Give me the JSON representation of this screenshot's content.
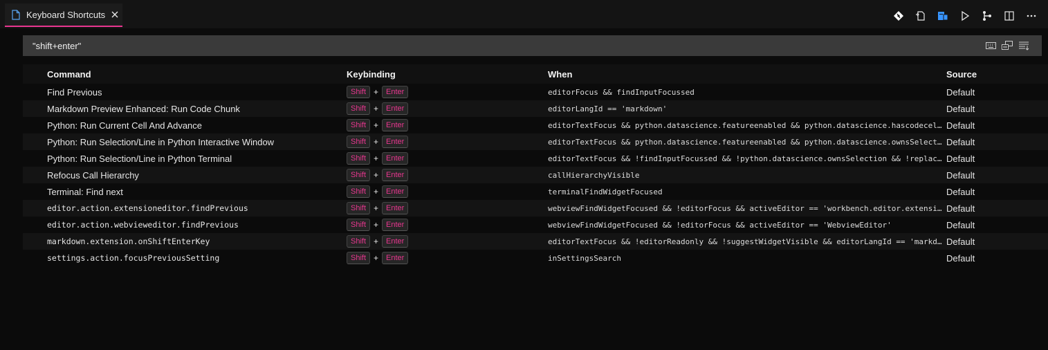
{
  "tab": {
    "label": "Keyboard Shortcuts"
  },
  "icons": {
    "file": "file-icon",
    "close": "close-icon",
    "actions": [
      "git-compare-icon",
      "open-file-icon",
      "preview-icon",
      "run-icon",
      "source-control-icon",
      "split-editor-icon",
      "more-icon"
    ],
    "search_tools": [
      "keyboard-icon",
      "record-keys-icon",
      "sort-by-precedence-icon"
    ]
  },
  "colors": {
    "accent": "#e8368f",
    "search_bg": "#3a3a3a",
    "blue_icon": "#3794ff"
  },
  "search": {
    "value": "\"shift+enter\""
  },
  "columns": {
    "command": "Command",
    "keybinding": "Keybinding",
    "when": "When",
    "source": "Source"
  },
  "rows": [
    {
      "command": "Find Previous",
      "keys": [
        "Shift",
        "Enter"
      ],
      "when": "editorFocus && findInputFocussed",
      "source": "Default"
    },
    {
      "command": "Markdown Preview Enhanced: Run Code Chunk",
      "keys": [
        "Shift",
        "Enter"
      ],
      "when": "editorLangId == 'markdown'",
      "source": "Default"
    },
    {
      "command": "Python: Run Current Cell And Advance",
      "keys": [
        "Shift",
        "Enter"
      ],
      "when": "editorTextFocus && python.datascience.featureenabled && python.datascience.hascodecells…",
      "source": "Default"
    },
    {
      "command": "Python: Run Selection/Line in Python Interactive Window",
      "keys": [
        "Shift",
        "Enter"
      ],
      "when": "editorTextFocus && python.datascience.featureenabled && python.datascience.ownsSelectio…",
      "source": "Default"
    },
    {
      "command": "Python: Run Selection/Line in Python Terminal",
      "keys": [
        "Shift",
        "Enter"
      ],
      "when": "editorTextFocus && !findInputFocussed && !python.datascience.ownsSelection && !replaceI…",
      "source": "Default"
    },
    {
      "command": "Refocus Call Hierarchy",
      "keys": [
        "Shift",
        "Enter"
      ],
      "when": "callHierarchyVisible",
      "source": "Default"
    },
    {
      "command": "Terminal: Find next",
      "keys": [
        "Shift",
        "Enter"
      ],
      "when": "terminalFindWidgetFocused",
      "source": "Default"
    },
    {
      "command": "editor.action.extensioneditor.findPrevious",
      "keys": [
        "Shift",
        "Enter"
      ],
      "when": "webviewFindWidgetFocused && !editorFocus && activeEditor == 'workbench.editor.extension'",
      "source": "Default"
    },
    {
      "command": "editor.action.webvieweditor.findPrevious",
      "keys": [
        "Shift",
        "Enter"
      ],
      "when": "webviewFindWidgetFocused && !editorFocus && activeEditor == 'WebviewEditor'",
      "source": "Default"
    },
    {
      "command": "markdown.extension.onShiftEnterKey",
      "keys": [
        "Shift",
        "Enter"
      ],
      "when": "editorTextFocus && !editorReadonly && !suggestWidgetVisible && editorLangId == 'markdow…",
      "source": "Default"
    },
    {
      "command": "settings.action.focusPreviousSetting",
      "keys": [
        "Shift",
        "Enter"
      ],
      "when": "inSettingsSearch",
      "source": "Default"
    }
  ]
}
